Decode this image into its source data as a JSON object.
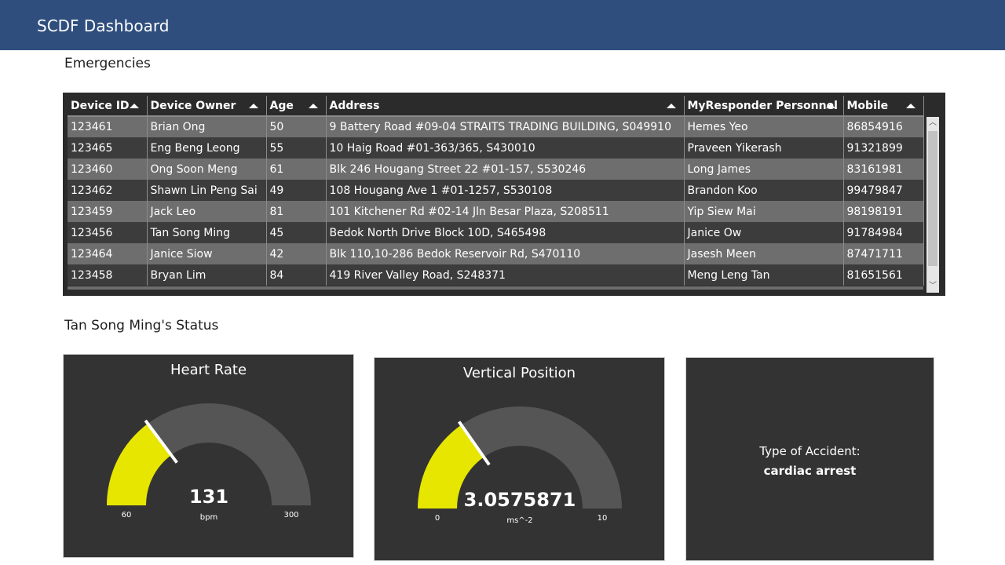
{
  "header": {
    "title": "SCDF Dashboard"
  },
  "emergencies": {
    "title": "Emergencies",
    "columns": [
      "Device ID",
      "Device Owner",
      "Age",
      "Address",
      "MyResponder Personnel",
      "Mobile"
    ],
    "rows": [
      [
        "123461",
        "Brian Ong",
        "50",
        "9 Battery Road #09-04 STRAITS TRADING BUILDING, S049910",
        "Hemes Yeo",
        "86854916"
      ],
      [
        "123465",
        "Eng Beng Leong",
        "55",
        "10 Haig Road #01-363/365, S430010",
        "Praveen Yikerash",
        "91321899"
      ],
      [
        "123460",
        "Ong Soon Meng",
        "61",
        "Blk 246 Hougang Street 22 #01-157, S530246",
        "Long James",
        "83161981"
      ],
      [
        "123462",
        "Shawn Lin Peng Sai",
        "49",
        "108 Hougang Ave 1 #01-1257, S530108",
        "Brandon Koo",
        "99479847"
      ],
      [
        "123459",
        "Jack Leo",
        "81",
        "101 Kitchener Rd #02-14 Jln Besar Plaza, S208511",
        "Yip Siew Mai",
        "98198191"
      ],
      [
        "123456",
        "Tan Song Ming",
        "45",
        "Bedok North Drive Block 10D, S465498",
        "Janice Ow",
        "91784984"
      ],
      [
        "123464",
        "Janice Siow",
        "42",
        "Blk 110,10-286 Bedok Reservoir Rd, S470110",
        "Jasesh Meen",
        "87471711"
      ],
      [
        "123458",
        "Bryan Lim",
        "84",
        "419 River Valley Road, S248371",
        "Meng Leng Tan",
        "81651561"
      ]
    ]
  },
  "status": {
    "title": "Tan Song Ming's Status",
    "heart_rate": {
      "title": "Heart Rate",
      "value": 131,
      "value_label": "131",
      "min": 60,
      "max": 300,
      "min_label": "60",
      "max_label": "300",
      "unit": "bpm"
    },
    "vertical_position": {
      "title": "Vertical Position",
      "value": 3.0575871,
      "value_label": "3.0575871",
      "min": 0,
      "max": 10,
      "min_label": "0",
      "max_label": "10",
      "unit": "ms^-2"
    },
    "accident": {
      "label": "Type of Accident:",
      "value": "cardiac arrest"
    }
  },
  "colors": {
    "header_bg": "#2f4e7d",
    "gauge_fill": "#e6e600",
    "gauge_track": "#555555",
    "card_bg": "#333333"
  }
}
